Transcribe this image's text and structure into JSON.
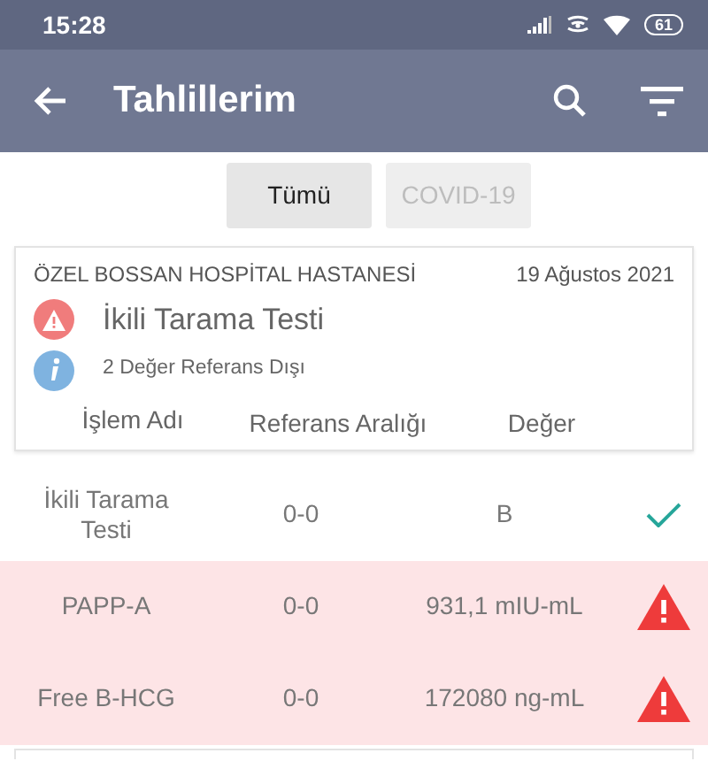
{
  "status_bar": {
    "time": "15:28",
    "battery": "61"
  },
  "app_bar": {
    "title": "Tahlillerim"
  },
  "filters": [
    {
      "label": "Tümü",
      "selected": true
    },
    {
      "label": "COVID-19",
      "selected": false
    }
  ],
  "report": {
    "hospital": "ÖZEL BOSSAN HOSPİTAL HASTANESİ",
    "date": "19 Ağustos 2021",
    "test_name": "İkili Tarama Testi",
    "note": "2 Değer Referans Dışı",
    "columns": [
      "İşlem Adı",
      "Referans Aralığı",
      "Değer"
    ]
  },
  "rows": [
    {
      "name": "İkili Tarama Testi",
      "range": "0-0",
      "value": "B",
      "out_of_range": false
    },
    {
      "name": "PAPP-A",
      "range": "0-0",
      "value": "931,1 mIU-mL",
      "out_of_range": true
    },
    {
      "name": "Free B-HCG",
      "range": "0-0",
      "value": "172080 ng-mL",
      "out_of_range": true
    }
  ]
}
